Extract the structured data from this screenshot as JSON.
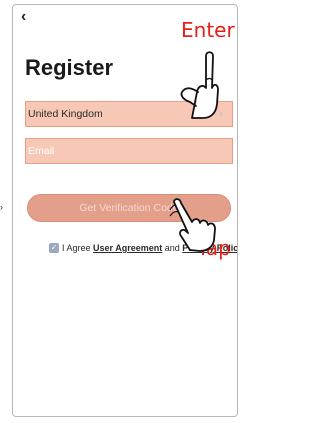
{
  "nav": {
    "back_icon": "chevron-left-icon",
    "back_glyph": "‹"
  },
  "page": {
    "title": "Register"
  },
  "form": {
    "country": {
      "value": "United Kingdom",
      "chevron": "›"
    },
    "email": {
      "placeholder": "Email"
    },
    "verify_button": {
      "label": "Get Verification Code"
    }
  },
  "agreement": {
    "checkbox_icon": "checkbox-checked-icon",
    "checkbox_glyph": "✓",
    "prefix": "I Agree ",
    "user_agreement": "User Agreement",
    "and": " and ",
    "privacy_policy": "Privacy Policy"
  },
  "annotations": {
    "enter": "Enter",
    "tap": "Tap",
    "side_arrow_glyph": "›"
  },
  "colors": {
    "field_bg": "#f7c8b6",
    "field_border": "#ea9f84",
    "button_bg": "#e49f8b",
    "annotation_red": "#e32119"
  }
}
